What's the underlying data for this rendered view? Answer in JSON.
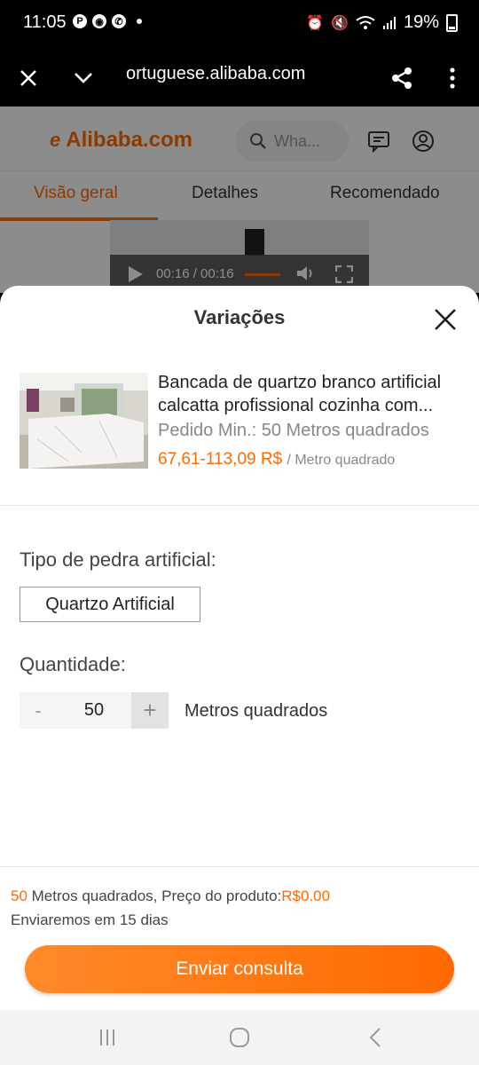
{
  "status_bar": {
    "time": "11:05",
    "battery": "19%"
  },
  "browser": {
    "url": "ortuguese.alibaba.com"
  },
  "site": {
    "logo": "Alibaba.com",
    "search_placeholder": "Wha...",
    "tabs": [
      {
        "label": "Visão geral"
      },
      {
        "label": "Detalhes"
      },
      {
        "label": "Recomendado"
      }
    ],
    "video_time": "00:16 / 00:16"
  },
  "sheet": {
    "title": "Variações",
    "product": {
      "title_line1": "Bancada de quartzo branco artificial",
      "title_line2": "calcatta profissional cozinha com...",
      "min_order": "Pedido Min.: 50 Metros quadrados",
      "price": "67,61-113,09 R$",
      "price_unit": "/ Metro quadrado"
    },
    "stone_type_label": "Tipo de pedra artificial:",
    "stone_option": "Quartzo Artificial",
    "quantity_label": "Quantidade:",
    "quantity": {
      "minus": "-",
      "value": "50",
      "plus": "+"
    },
    "quantity_unit": "Metros quadrados",
    "summary": {
      "count": "50",
      "text": " Metros quadrados, Preço do produto:",
      "price": "R$0.00"
    },
    "shipping": "Enviaremos em 15 dias",
    "cta": "Enviar consulta"
  },
  "colors": {
    "accent": "#ff6a00"
  }
}
